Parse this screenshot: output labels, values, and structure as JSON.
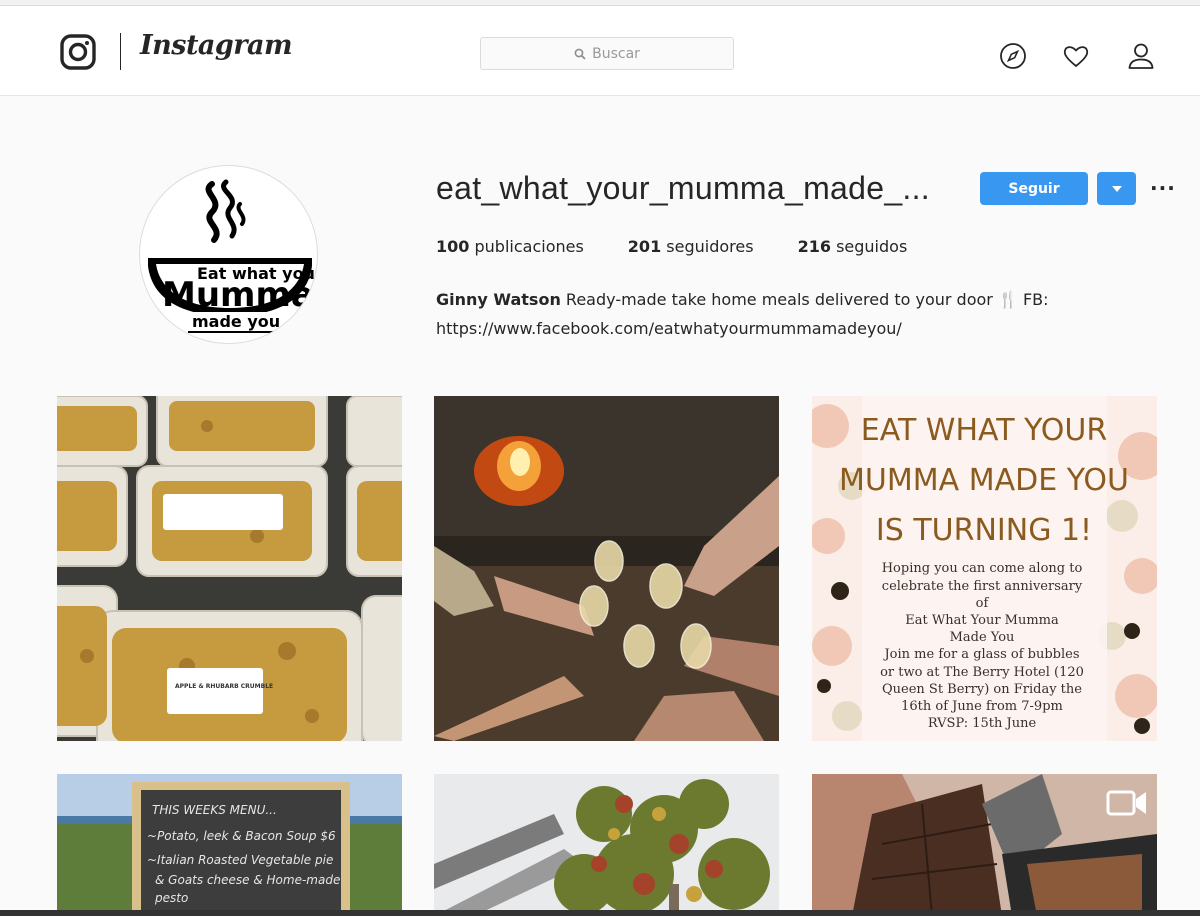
{
  "header": {
    "wordmark": "Instagram",
    "search_placeholder": "Buscar",
    "icons": [
      "instagram-glyph-icon",
      "search-icon",
      "compass-icon",
      "heart-icon",
      "person-icon"
    ]
  },
  "profile": {
    "avatar_text": [
      "Eat what your",
      "Mumma",
      "made you"
    ],
    "username": "eat_what_your_mumma_made_...",
    "follow_label": "Seguir",
    "more_label": "···",
    "stats": [
      {
        "count": "100",
        "label": "publicaciones"
      },
      {
        "count": "201",
        "label": "seguidores"
      },
      {
        "count": "216",
        "label": "seguidos"
      }
    ],
    "bio_name": "Ginny Watson",
    "bio_text": "Ready-made take home meals delivered to your door 🍴 FB:",
    "bio_link": "https://www.facebook.com/eatwhatyourmummamadeyou/"
  },
  "posts": {
    "post1_label": "APPLE & RHUBARB CRUMBLE",
    "post3_title": [
      "EAT WHAT YOUR",
      "MUMMA MADE YOU",
      "IS TURNING 1!"
    ],
    "post3_body": [
      "Hoping you can come along to",
      "celebrate the first anniversary",
      "of",
      "Eat What Your Mumma",
      "Made You",
      "Join me for a glass of bubbles",
      "or two at The Berry Hotel (120",
      "Queen St Berry) on Friday the",
      "16th of June from 7-9pm",
      "RVSP: 15th June"
    ],
    "post4_menu": [
      "THIS WEEKS MENU...",
      "~Potato, leek & Bacon Soup $6",
      "~Italian Roasted Vegetable pie",
      "& Goats cheese & Home-made",
      "pesto"
    ]
  },
  "colors": {
    "accent": "#3897f0",
    "text": "#262626",
    "background": "#fafafa"
  }
}
